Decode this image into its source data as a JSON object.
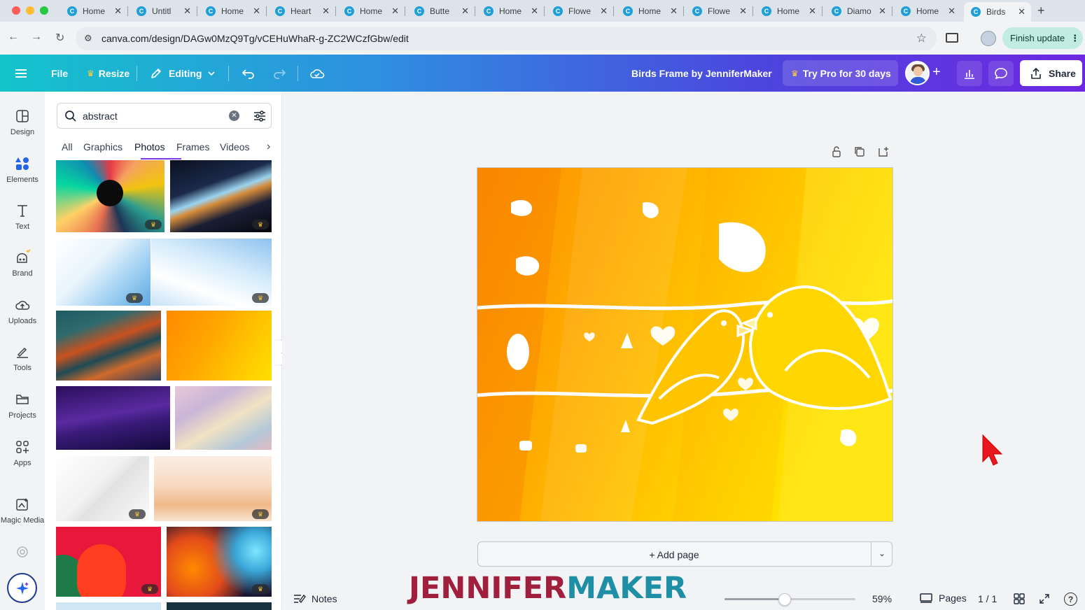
{
  "browser": {
    "tabs": [
      {
        "label": "Home"
      },
      {
        "label": "Untitl"
      },
      {
        "label": "Home"
      },
      {
        "label": "Heart"
      },
      {
        "label": "Home"
      },
      {
        "label": "Butte"
      },
      {
        "label": "Home"
      },
      {
        "label": "Flowe"
      },
      {
        "label": "Home"
      },
      {
        "label": "Flowe"
      },
      {
        "label": "Home"
      },
      {
        "label": "Diamo"
      },
      {
        "label": "Home"
      },
      {
        "label": "Birds",
        "active": true
      }
    ],
    "url": "canva.com/design/DAGw0MzQ9Tg/vCEHuWhaR-g-ZC2WCzfGbw/edit",
    "finish_update_label": "Finish update"
  },
  "toolbar": {
    "file_label": "File",
    "resize_label": "Resize",
    "editing_label": "Editing",
    "doc_title": "Birds Frame by JenniferMaker",
    "try_pro_label": "Try Pro for 30 days",
    "share_label": "Share"
  },
  "rail": {
    "items": [
      {
        "label": "Design",
        "icon": "design-icon"
      },
      {
        "label": "Elements",
        "icon": "elements-icon"
      },
      {
        "label": "Text",
        "icon": "text-icon"
      },
      {
        "label": "Brand",
        "icon": "brand-icon"
      },
      {
        "label": "Uploads",
        "icon": "uploads-icon"
      },
      {
        "label": "Tools",
        "icon": "tools-icon"
      },
      {
        "label": "Projects",
        "icon": "projects-icon"
      },
      {
        "label": "Apps",
        "icon": "apps-icon"
      },
      {
        "label": "Magic Media",
        "icon": "magic-media-icon"
      }
    ]
  },
  "panel": {
    "search_value": "abstract",
    "tabs": [
      "All",
      "Graphics",
      "Photos",
      "Frames",
      "Videos"
    ],
    "active_tab": "Photos"
  },
  "canvas": {
    "add_page_label": "+ Add page"
  },
  "bottom": {
    "notes_label": "Notes",
    "zoom_value": "59%",
    "zoom_fraction": 0.46,
    "pages_label": "Pages",
    "page_count": "1 / 1"
  },
  "watermark": {
    "part1": "JENNIFER",
    "part2": "MAKER"
  },
  "colors": {
    "header_gradient_start": "#14c4cb",
    "header_gradient_end": "#6d28e0",
    "active_tab_underline": "#7c3aed",
    "design_orange": "#fb8c00",
    "design_yellow": "#ffe100"
  }
}
